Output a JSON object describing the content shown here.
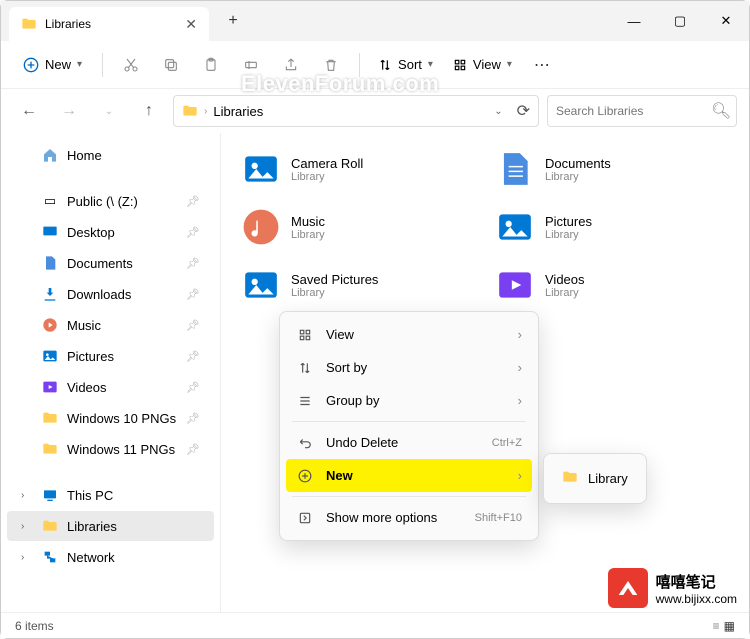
{
  "tab": {
    "title": "Libraries"
  },
  "toolbar": {
    "new": "New",
    "sort": "Sort",
    "view": "View"
  },
  "address": {
    "path": "Libraries"
  },
  "search": {
    "placeholder": "Search Libraries"
  },
  "sidebar": {
    "home": "Home",
    "items": [
      {
        "label": "Public (\\                     (Z:)"
      },
      {
        "label": "Desktop"
      },
      {
        "label": "Documents"
      },
      {
        "label": "Downloads"
      },
      {
        "label": "Music"
      },
      {
        "label": "Pictures"
      },
      {
        "label": "Videos"
      },
      {
        "label": "Windows 10 PNGs"
      },
      {
        "label": "Windows 11 PNGs"
      }
    ],
    "bottom": [
      {
        "label": "This PC"
      },
      {
        "label": "Libraries"
      },
      {
        "label": "Network"
      }
    ]
  },
  "libraries": [
    {
      "name": "Camera Roll",
      "sub": "Library"
    },
    {
      "name": "Documents",
      "sub": "Library"
    },
    {
      "name": "Music",
      "sub": "Library"
    },
    {
      "name": "Pictures",
      "sub": "Library"
    },
    {
      "name": "Saved Pictures",
      "sub": "Library"
    },
    {
      "name": "Videos",
      "sub": "Library"
    }
  ],
  "ctx": {
    "view": "View",
    "sortby": "Sort by",
    "groupby": "Group by",
    "undo": "Undo Delete",
    "undo_sc": "Ctrl+Z",
    "new": "New",
    "more": "Show more options",
    "more_sc": "Shift+F10"
  },
  "submenu": {
    "library": "Library"
  },
  "status": {
    "count": "6 items"
  },
  "watermark1": "ElevenForum.com",
  "watermark2": {
    "line1": "嘻嘻笔记",
    "line2": "www.bijixx.com"
  }
}
